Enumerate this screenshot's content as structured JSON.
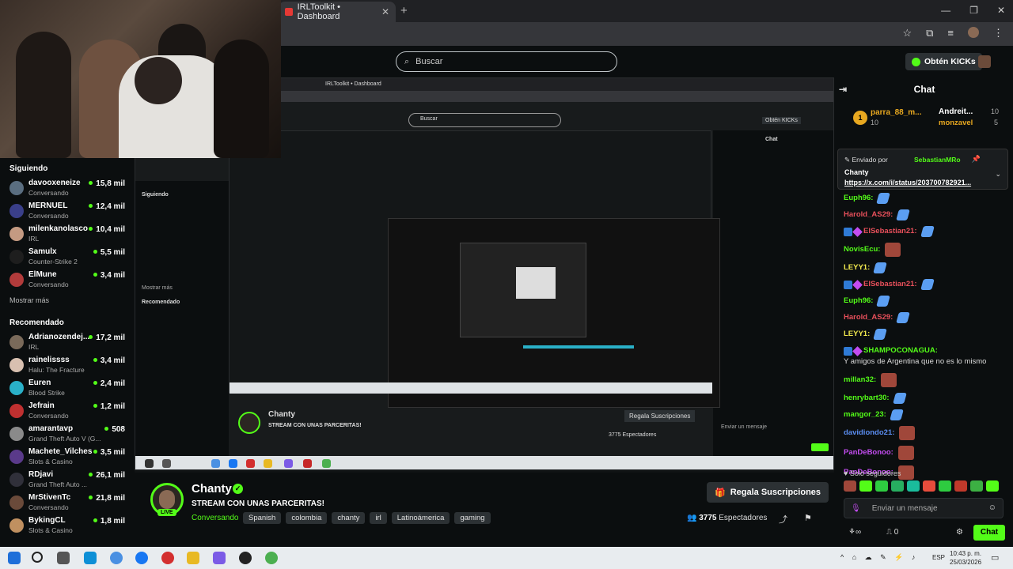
{
  "browser": {
    "tab_title": "IRLToolkit • Dashboard",
    "new_tab": "+",
    "tab_close": "✕",
    "window_controls": [
      "—",
      "❐",
      "✕"
    ]
  },
  "header": {
    "search_placeholder": "Buscar",
    "kicks_button": "Obtén KICKs"
  },
  "sidebar": {
    "following_title": "Siguiendo",
    "following": [
      {
        "name": "davooxeneize",
        "category": "Conversando",
        "viewers": "15,8 mil",
        "color": "#5a6e80"
      },
      {
        "name": "MERNUEL",
        "category": "Conversando",
        "viewers": "12,4 mil",
        "color": "#3a3f8a"
      },
      {
        "name": "milenkanolasco",
        "category": "IRL",
        "viewers": "10,4 mil",
        "color": "#c49a82"
      },
      {
        "name": "Samulx",
        "category": "Counter-Strike 2",
        "viewers": "5,5 mil",
        "color": "#1e1e1e"
      },
      {
        "name": "ElMune",
        "category": "Conversando",
        "viewers": "3,4 mil",
        "color": "#b23b3b"
      }
    ],
    "show_more": "Mostrar más",
    "recommended_title": "Recomendado",
    "recommended": [
      {
        "name": "Adrianozendej...",
        "category": "IRL",
        "viewers": "17,2 mil",
        "color": "#7a6a5a"
      },
      {
        "name": "rainelissss",
        "category": "Halu: The Fracture",
        "viewers": "3,4 mil",
        "color": "#d8c0b0"
      },
      {
        "name": "Euren",
        "category": "Blood Strike",
        "viewers": "2,4 mil",
        "color": "#2ab0c8"
      },
      {
        "name": "Jefrain",
        "category": "Conversando",
        "viewers": "1,2 mil",
        "color": "#c03030"
      },
      {
        "name": "amarantavp",
        "category": "Grand Theft Auto V (G...",
        "viewers": "508",
        "color": "#8a8a8a"
      },
      {
        "name": "Machete_Vilches",
        "category": "Slots & Casino",
        "viewers": "3,5 mil",
        "color": "#5a3a8a"
      },
      {
        "name": "RDjavi",
        "category": "Grand Theft Auto ...",
        "viewers": "26,1 mil",
        "color": "#30303a"
      },
      {
        "name": "MrStivenTc",
        "category": "Conversando",
        "viewers": "21,8 mil",
        "color": "#6a4a3a"
      },
      {
        "name": "BykingCL",
        "category": "Slots & Casino",
        "viewers": "1,8 mil",
        "color": "#c09060"
      }
    ]
  },
  "stream": {
    "streamer": "Chanty",
    "verified": "✓",
    "live_badge": "LIVE",
    "title": "STREAM CON UNAS PARCERITAS!",
    "category": "Conversando",
    "tags": [
      "Spanish",
      "colombia",
      "chanty",
      "irl",
      "Latinoámerica",
      "gaming"
    ],
    "subs_button": "Regala Suscripciones",
    "viewers_count": "3775",
    "viewers_label": "Espectadores"
  },
  "chat": {
    "title": "Chat",
    "leaders": [
      {
        "rank": "1",
        "name": "parra_88_m...",
        "count": "10"
      },
      {
        "name": "Andreit...",
        "count": "10"
      },
      {
        "name": "monzavel",
        "count": "5"
      }
    ],
    "pinned": {
      "by_label": "Enviado por",
      "by_user": "SebastianMRo",
      "author": "Chanty",
      "link": "https://x.com/i/status/203700782921..."
    },
    "messages": [
      {
        "user": "Euph96:",
        "color": "#53fc18",
        "emote": "blue"
      },
      {
        "user": "Harold_AS29:",
        "color": "#e8505b",
        "emote": "blue"
      },
      {
        "user": "ElSebastian21:",
        "color": "#e8505b",
        "emote": "blue",
        "badges": true
      },
      {
        "user": "NovisEcu:",
        "color": "#53fc18",
        "emote": "red"
      },
      {
        "user": "LEYY1:",
        "color": "#f2e94e",
        "emote": "blue"
      },
      {
        "user": "ElSebastian21:",
        "color": "#e8505b",
        "emote": "blue",
        "badges": true
      },
      {
        "user": "Euph96:",
        "color": "#53fc18",
        "emote": "blue"
      },
      {
        "user": "Harold_AS29:",
        "color": "#e8505b",
        "emote": "blue"
      },
      {
        "user": "LEYY1:",
        "color": "#f2e94e",
        "emote": "blue"
      },
      {
        "user": "SHAMPOCONAGUA:",
        "color": "#53fc18",
        "text": "Y amigos de Argentina que no es lo mismo",
        "badges": true
      },
      {
        "user": "millan32:",
        "color": "#53fc18",
        "emote": "red"
      },
      {
        "user": "henrybart30:",
        "color": "#53fc18",
        "emote": "blue"
      },
      {
        "user": "mangor_23:",
        "color": "#53fc18",
        "emote": "blue"
      },
      {
        "user": "davidiondo21:",
        "color": "#5b8ef2",
        "emote": "red"
      },
      {
        "user": "PanDeBonoo:",
        "color": "#c34cf0",
        "emote": "red"
      },
      {
        "user": "PanDeBonoo:",
        "color": "#c34cf0",
        "emote": "red"
      }
    ],
    "followers_only": "Solo seguidores",
    "input_placeholder": "Enviar un mensaje",
    "kicks_count": "0",
    "chat_button": "Chat"
  },
  "taskbar": {
    "tray_icons": "^ ⌂ ☁ ✎ ⚡ ♪",
    "language": "ESP",
    "time": "10:43 p. m.",
    "date": "25/03/2026"
  },
  "nested": {
    "tab_title": "IRLToolkit • Dashboard",
    "search": "Buscar",
    "kicks": "Obtén KICKs",
    "chat": "Chat",
    "streamer": "Chanty",
    "title": "STREAM CON UNAS PARCERITAS!",
    "subs": "Regala Suscripciones",
    "viewers": "3775 Espectadores",
    "following": "Siguiendo",
    "recommended": "Recomendado",
    "show_more": "Mostrar más",
    "send": "Enviar un mensaje"
  }
}
